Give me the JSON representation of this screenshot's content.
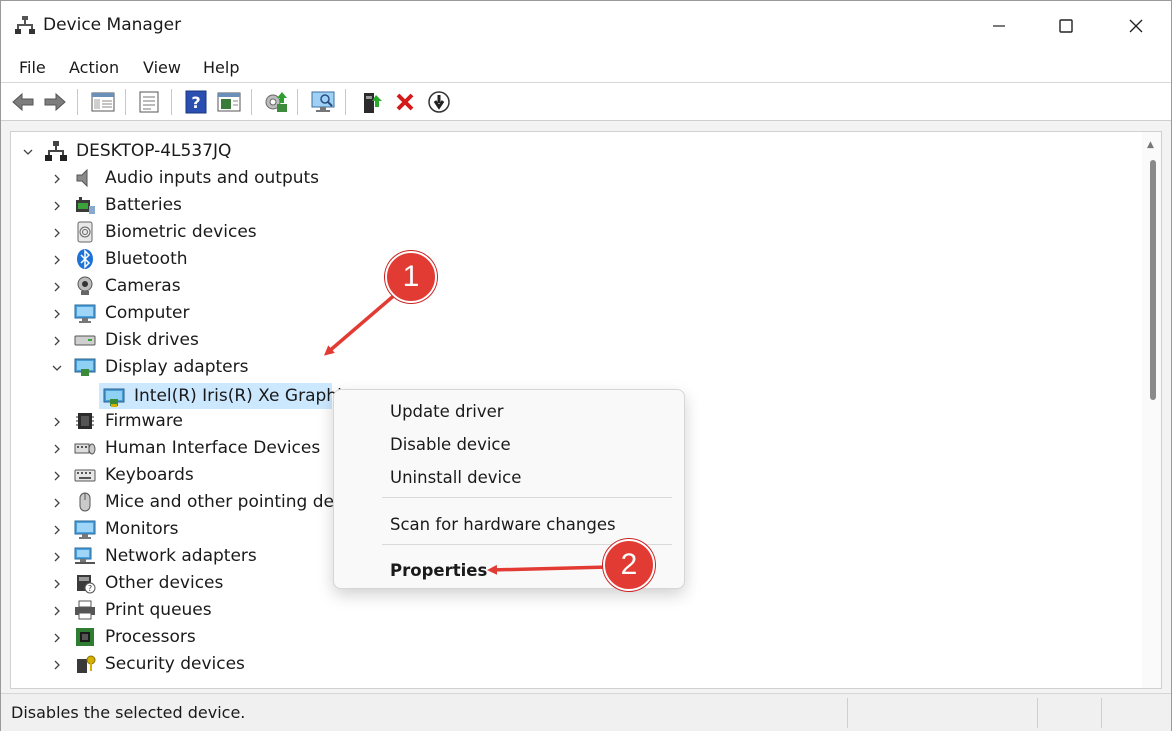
{
  "window": {
    "title": "Device Manager"
  },
  "menubar": {
    "items": [
      "File",
      "Action",
      "View",
      "Help"
    ]
  },
  "toolbar": {
    "buttons": [
      "back-arrow-icon",
      "forward-arrow-icon",
      "show-hide-console-tree-icon",
      "properties-icon",
      "help-icon",
      "action-pane-icon",
      "update-driver-icon",
      "scan-hardware-icon",
      "enable-device-icon",
      "uninstall-device-icon",
      "disable-device-icon"
    ]
  },
  "tree": {
    "root": "DESKTOP-4L537JQ",
    "categories": [
      {
        "label": "Audio inputs and outputs",
        "icon": "speaker-icon"
      },
      {
        "label": "Batteries",
        "icon": "battery-icon"
      },
      {
        "label": "Biometric devices",
        "icon": "fingerprint-icon"
      },
      {
        "label": "Bluetooth",
        "icon": "bluetooth-icon"
      },
      {
        "label": "Cameras",
        "icon": "camera-icon"
      },
      {
        "label": "Computer",
        "icon": "monitor-icon"
      },
      {
        "label": "Disk drives",
        "icon": "disk-drive-icon"
      },
      {
        "label": "Display adapters",
        "icon": "display-adapter-icon",
        "expanded": true
      },
      {
        "label": "Firmware",
        "icon": "chip-icon"
      },
      {
        "label": "Human Interface Devices",
        "icon": "hid-icon"
      },
      {
        "label": "Keyboards",
        "icon": "keyboard-icon"
      },
      {
        "label": "Mice and other pointing devi",
        "icon": "mouse-icon"
      },
      {
        "label": "Monitors",
        "icon": "monitor-icon"
      },
      {
        "label": "Network adapters",
        "icon": "network-icon"
      },
      {
        "label": "Other devices",
        "icon": "unknown-device-icon"
      },
      {
        "label": "Print queues",
        "icon": "printer-icon"
      },
      {
        "label": "Processors",
        "icon": "processor-icon"
      },
      {
        "label": "Security devices",
        "icon": "security-key-icon"
      }
    ],
    "child": {
      "label": "Intel(R) Iris(R) Xe Graphics",
      "selected": true
    }
  },
  "context_menu": {
    "items": [
      "Update driver",
      "Disable device",
      "Uninstall device",
      "Scan for hardware changes",
      "Properties"
    ]
  },
  "annotations": {
    "badge1": "1",
    "badge2": "2"
  },
  "status": {
    "text": "Disables the selected device."
  },
  "colors": {
    "accent": "#cce8ff",
    "annotation": "#e23b34"
  }
}
